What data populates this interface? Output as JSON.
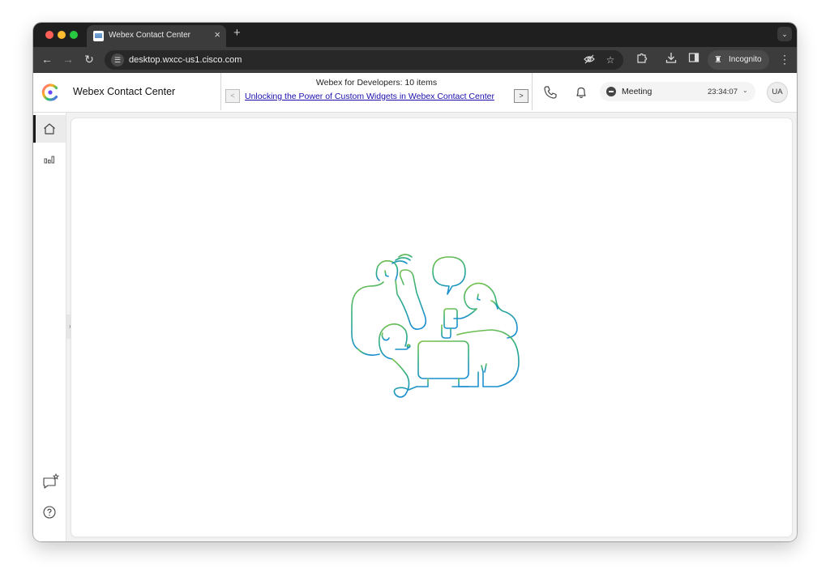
{
  "browser": {
    "tab": {
      "title": "Webex Contact Center"
    },
    "url": "desktop.wxcc-us1.cisco.com",
    "incognito_label": "Incognito",
    "icons": {
      "back": "arrow-left-icon",
      "forward": "arrow-right-icon",
      "reload": "reload-icon",
      "site_info": "tune-icon",
      "eye_off": "eye-off-icon",
      "bookmark": "star-icon",
      "extensions": "puzzle-icon",
      "download": "download-icon",
      "side_panel": "side-panel-icon",
      "menu": "kebab-icon"
    }
  },
  "app": {
    "title": "Webex Contact Center",
    "notice": {
      "count_text": "Webex for Developers: 10 items",
      "link_text": "Unlocking the Power of Custom Widgets in Webex Contact Center",
      "prev_label": "<",
      "next_label": ">"
    },
    "agent_state": {
      "label": "Meeting",
      "timer": "23:34:07"
    },
    "user_initials": "UA",
    "sidebar": {
      "items": [
        {
          "name": "home",
          "icon": "home-icon",
          "active": true
        },
        {
          "name": "analyzer",
          "icon": "bar-chart-icon",
          "active": false
        }
      ],
      "bottom": [
        {
          "name": "feedback",
          "icon": "chat-star-icon"
        },
        {
          "name": "help",
          "icon": "help-icon"
        }
      ]
    }
  },
  "colors": {
    "accent_gradient_start": "#7ac143",
    "accent_gradient_end": "#1a8fd0",
    "link": "#1a0dab"
  }
}
